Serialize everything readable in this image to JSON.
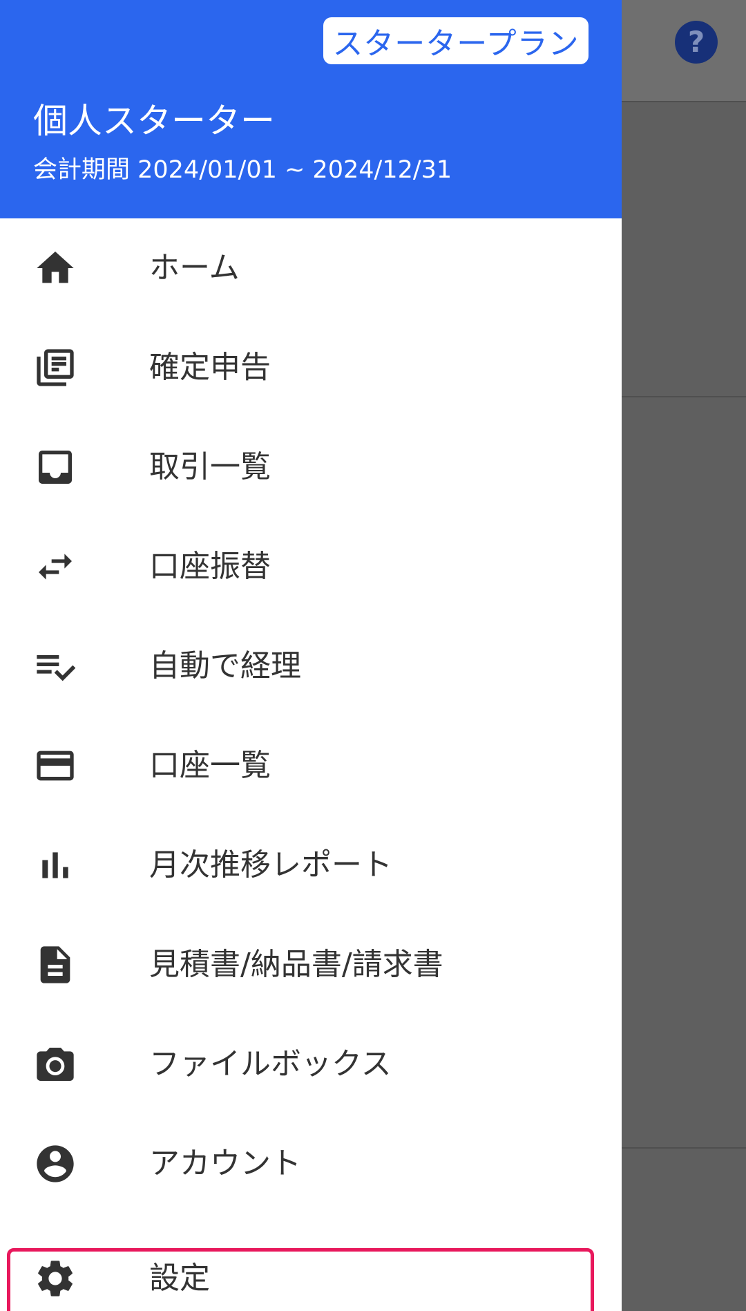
{
  "drawer": {
    "plan_badge": "スタータープラン",
    "org_name": "個人スターター",
    "fiscal_period": "会計期間 2024/01/01 ~ 2024/12/31",
    "items": [
      {
        "label": "ホーム",
        "icon": "home-icon"
      },
      {
        "label": "確定申告",
        "icon": "library-books-icon"
      },
      {
        "label": "取引一覧",
        "icon": "inbox-icon"
      },
      {
        "label": "口座振替",
        "icon": "swap-horiz-icon"
      },
      {
        "label": "自動で経理",
        "icon": "playlist-add-check-icon"
      },
      {
        "label": "口座一覧",
        "icon": "credit-card-icon"
      },
      {
        "label": "月次推移レポート",
        "icon": "bar-chart-icon"
      },
      {
        "label": "見積書/納品書/請求書",
        "icon": "description-icon"
      },
      {
        "label": "ファイルボックス",
        "icon": "camera-icon"
      },
      {
        "label": "アカウント",
        "icon": "account-circle-icon"
      },
      {
        "label": "設定",
        "icon": "settings-icon"
      }
    ]
  },
  "background": {
    "help_label": "?"
  },
  "colors": {
    "header_blue": "#2b66ee",
    "icon_text": "#333333",
    "highlight": "#e8185c",
    "overlay": "#5f5f5f"
  }
}
